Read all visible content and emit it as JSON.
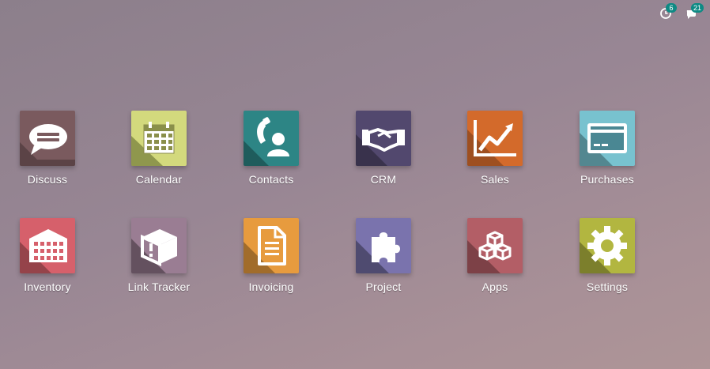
{
  "systray": {
    "activity_count": "6",
    "messages_count": "21"
  },
  "colors": {
    "badge": "#0e8a84",
    "discuss": "#7a5a5e",
    "calendar": "#d3d97d",
    "contacts": "#2d8585",
    "crm": "#52486e",
    "sales": "#d36a2b",
    "purchases": "#78c2cf",
    "inventory": "#d6606b",
    "link_tracker": "#9a7d93",
    "invoicing": "#e79b3e",
    "project": "#7a73ad",
    "apps": "#b35e66",
    "settings": "#b2b640"
  },
  "apps": [
    {
      "label": "Discuss",
      "icon": "speech-bubble-icon"
    },
    {
      "label": "Calendar",
      "icon": "calendar-icon"
    },
    {
      "label": "Contacts",
      "icon": "phone-person-icon"
    },
    {
      "label": "CRM",
      "icon": "handshake-icon"
    },
    {
      "label": "Sales",
      "icon": "trend-chart-icon"
    },
    {
      "label": "Purchases",
      "icon": "credit-card-icon"
    },
    {
      "label": "Inventory",
      "icon": "warehouse-icon"
    },
    {
      "label": "Link Tracker",
      "icon": "package-box-icon"
    },
    {
      "label": "Invoicing",
      "icon": "document-icon"
    },
    {
      "label": "Project",
      "icon": "puzzle-icon"
    },
    {
      "label": "Apps",
      "icon": "cubes-icon"
    },
    {
      "label": "Settings",
      "icon": "gear-icon"
    }
  ]
}
